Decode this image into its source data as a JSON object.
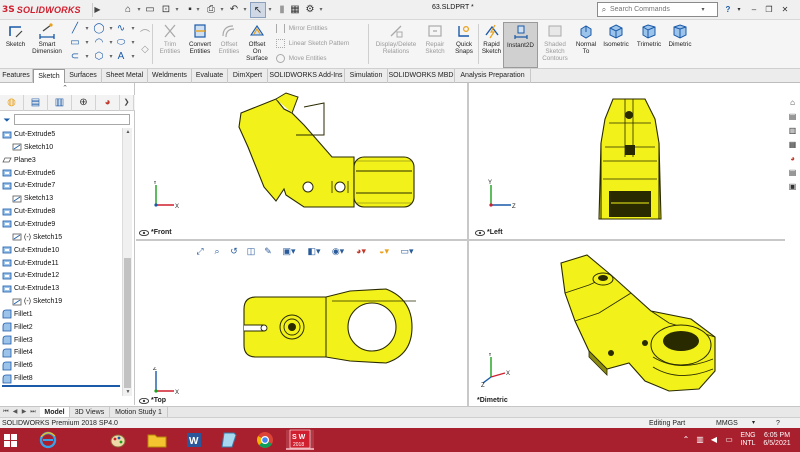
{
  "app": {
    "brand_ds": "3S",
    "brand_name": "SOLIDWORKS",
    "doc_title": "63.SLDPRT *",
    "search_placeholder": "Search Commands",
    "help_glyph": "?"
  },
  "ribbon": {
    "sketch": "Sketch",
    "smart_dimension": [
      "Smart",
      "Dimension"
    ],
    "trim_entities": [
      "Trim",
      "Entities"
    ],
    "convert_entities": [
      "Convert",
      "Entities"
    ],
    "offset_entities": [
      "Offset",
      "Entities"
    ],
    "offset_on_surface": [
      "Offset",
      "On",
      "Surface"
    ],
    "mirror_entities": "Mirror Entities",
    "linear_sketch_pattern": "Linear Sketch Pattern",
    "move_entities": "Move Entities",
    "display_delete_relations": [
      "Display/Delete",
      "Relations"
    ],
    "repair_sketch": [
      "Repair",
      "Sketch"
    ],
    "quick_snaps": [
      "Quick",
      "Snaps"
    ],
    "rapid_sketch": [
      "Rapid",
      "Sketch"
    ],
    "instant2d": "Instant2D",
    "shaded_sketch_contours": [
      "Shaded",
      "Sketch",
      "Contours"
    ],
    "normal_to": [
      "Normal",
      "To"
    ],
    "isometric": "Isometric",
    "trimetric": "Trimetric",
    "dimetric": "Dimetric"
  },
  "tabs": [
    {
      "label": "Features",
      "active": false
    },
    {
      "label": "Sketch",
      "active": true
    },
    {
      "label": "Surfaces",
      "active": false
    },
    {
      "label": "Sheet Metal",
      "active": false
    },
    {
      "label": "Weldments",
      "active": false
    },
    {
      "label": "Evaluate",
      "active": false
    },
    {
      "label": "DimXpert",
      "active": false
    },
    {
      "label": "SOLIDWORKS Add-Ins",
      "active": false
    },
    {
      "label": "Simulation",
      "active": false
    },
    {
      "label": "SOLIDWORKS MBD",
      "active": false
    },
    {
      "label": "Analysis Preparation",
      "active": false
    }
  ],
  "tree": [
    {
      "label": "Cut-Extrude5",
      "type": "cut",
      "indent": 0
    },
    {
      "label": "Sketch10",
      "type": "sketch",
      "indent": 1
    },
    {
      "label": "Plane3",
      "type": "plane",
      "indent": 0
    },
    {
      "label": "Cut-Extrude6",
      "type": "cut",
      "indent": 0
    },
    {
      "label": "Cut-Extrude7",
      "type": "cut",
      "indent": 0
    },
    {
      "label": "Sketch13",
      "type": "sketch",
      "indent": 1
    },
    {
      "label": "Cut-Extrude8",
      "type": "cut",
      "indent": 0
    },
    {
      "label": "Cut-Extrude9",
      "type": "cut",
      "indent": 0
    },
    {
      "label": "(-) Sketch15",
      "type": "sketch",
      "indent": 1
    },
    {
      "label": "Cut-Extrude10",
      "type": "cut",
      "indent": 0
    },
    {
      "label": "Cut-Extrude11",
      "type": "cut",
      "indent": 0
    },
    {
      "label": "Cut-Extrude12",
      "type": "cut",
      "indent": 0
    },
    {
      "label": "Cut-Extrude13",
      "type": "cut",
      "indent": 0
    },
    {
      "label": "(-) Sketch19",
      "type": "sketch",
      "indent": 1
    },
    {
      "label": "Fillet1",
      "type": "fillet",
      "indent": 0
    },
    {
      "label": "Fillet2",
      "type": "fillet",
      "indent": 0
    },
    {
      "label": "Fillet3",
      "type": "fillet",
      "indent": 0
    },
    {
      "label": "Fillet4",
      "type": "fillet",
      "indent": 0
    },
    {
      "label": "Fillet6",
      "type": "fillet",
      "indent": 0
    },
    {
      "label": "Fillet8",
      "type": "fillet",
      "indent": 0
    }
  ],
  "viewports": {
    "front": "*Front",
    "left": "*Left",
    "top": "*Top",
    "dimetric": "*Dimetric"
  },
  "axes": {
    "x": "X",
    "y": "Y",
    "z": "Z"
  },
  "bottom_tabs": [
    "Model",
    "3D Views",
    "Motion Study 1"
  ],
  "status": {
    "product": "SOLIDWORKS Premium 2018 SP4.0",
    "mode": "Editing Part",
    "units": "MMGS"
  },
  "taskbar": {
    "sw_badge": "S W",
    "sw_year": "2018",
    "lang1": "ENG",
    "lang2": "INTL",
    "time": "6:05 PM",
    "date": "6/5/2021"
  },
  "colors": {
    "part_yellow": "#f2f21a",
    "part_dark": "#2a2a00",
    "taskbar": "#a81f2d",
    "brand_red": "#d01f2f"
  }
}
